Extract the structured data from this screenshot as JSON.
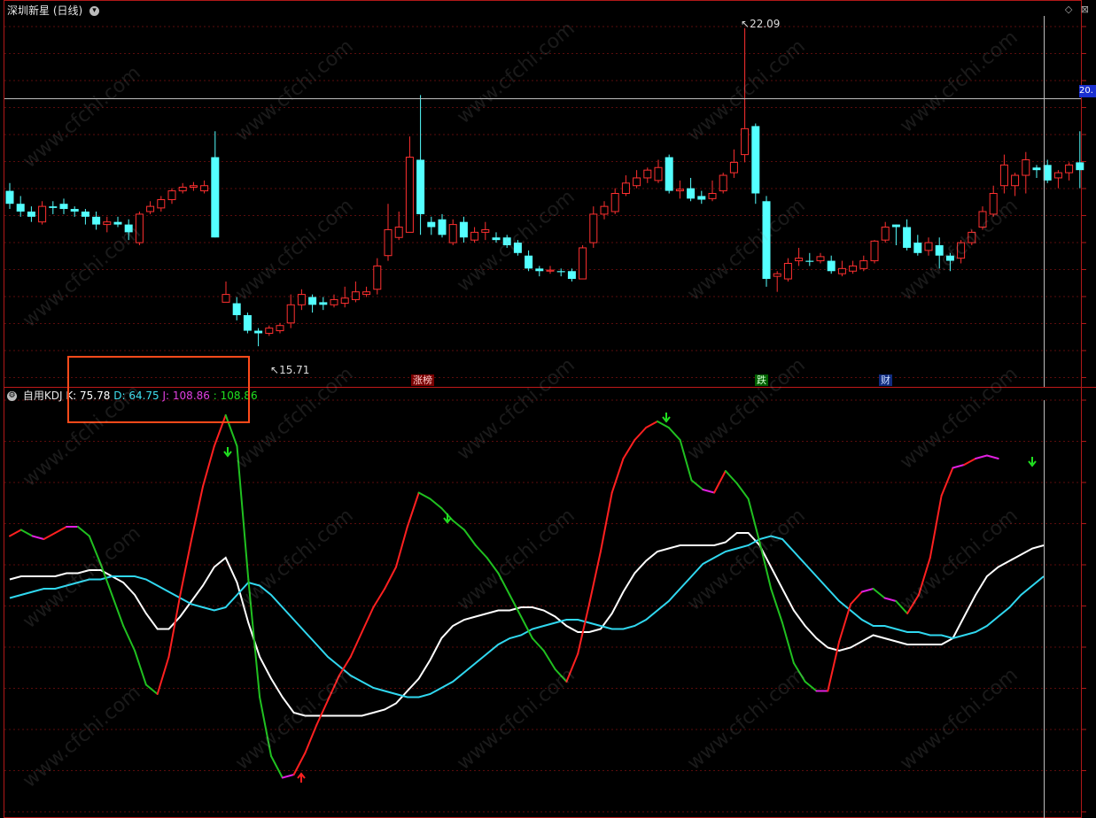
{
  "title": "深圳新星 (日线)",
  "title_icon": "chevron-down-icon",
  "corner_icons": [
    "diamond-icon",
    "close-icon"
  ],
  "price_tag": "20.",
  "kdj": {
    "name": "自用KDJ",
    "k_label": "K: 75.78",
    "d_label": "D: 64.75",
    "j_label": "J: 108.86",
    "j2_label": ": 108.86"
  },
  "markers": {
    "high_label": "22.09",
    "low_label": "15.71",
    "tag1": "涨榜",
    "tag2": "跌",
    "tag3": "财"
  },
  "watermark": "www.cfchi.com",
  "colors": {
    "up": "#ff3030",
    "down": "#54ffff",
    "k": "#ffffff",
    "d": "#30d8f0",
    "j_up": "#ff2020",
    "j_down": "#20c020",
    "j_flat": "#e020e0"
  },
  "chart_data": [
    {
      "type": "candlestick",
      "title": "深圳新星 (日线)",
      "high_mark": 22.09,
      "low_mark": 15.71,
      "ylim": [
        15.2,
        22.6
      ],
      "candles": [
        [
          18.95,
          18.7,
          19.1,
          18.6
        ],
        [
          18.7,
          18.55,
          18.85,
          18.45
        ],
        [
          18.55,
          18.45,
          18.65,
          18.35
        ],
        [
          18.35,
          18.65,
          18.75,
          18.3
        ],
        [
          18.65,
          18.62,
          18.75,
          18.5
        ],
        [
          18.7,
          18.6,
          18.8,
          18.5
        ],
        [
          18.6,
          18.55,
          18.65,
          18.45
        ],
        [
          18.55,
          18.45,
          18.6,
          18.3
        ],
        [
          18.45,
          18.3,
          18.55,
          18.2
        ],
        [
          18.3,
          18.35,
          18.45,
          18.15
        ],
        [
          18.35,
          18.3,
          18.45,
          18.25
        ],
        [
          18.3,
          18.15,
          18.4,
          18.0
        ],
        [
          17.95,
          18.5,
          18.55,
          17.9
        ],
        [
          18.55,
          18.65,
          18.75,
          18.5
        ],
        [
          18.62,
          18.78,
          18.85,
          18.55
        ],
        [
          18.78,
          18.95,
          19.0,
          18.7
        ],
        [
          18.95,
          19.02,
          19.1,
          18.9
        ],
        [
          19.02,
          19.05,
          19.12,
          18.95
        ],
        [
          18.95,
          19.05,
          19.15,
          18.9
        ],
        [
          19.6,
          18.05,
          20.1,
          18.05
        ],
        [
          16.8,
          16.95,
          17.2,
          16.8
        ],
        [
          16.78,
          16.55,
          16.9,
          16.45
        ],
        [
          16.55,
          16.25,
          16.6,
          16.2
        ],
        [
          16.25,
          16.2,
          16.3,
          15.95
        ],
        [
          16.2,
          16.3,
          16.35,
          16.15
        ],
        [
          16.25,
          16.35,
          16.4,
          16.2
        ],
        [
          16.4,
          16.75,
          16.95,
          16.3
        ],
        [
          16.75,
          16.95,
          17.05,
          16.65
        ],
        [
          16.9,
          16.75,
          16.95,
          16.6
        ],
        [
          16.8,
          16.75,
          16.9,
          16.65
        ],
        [
          16.75,
          16.85,
          16.95,
          16.7
        ],
        [
          16.78,
          16.88,
          17.1,
          16.7
        ],
        [
          16.85,
          17.0,
          17.2,
          16.8
        ],
        [
          16.95,
          17.0,
          17.1,
          16.9
        ],
        [
          17.05,
          17.5,
          17.65,
          16.95
        ],
        [
          17.7,
          18.2,
          18.7,
          17.6
        ],
        [
          18.05,
          18.25,
          18.55,
          18.0
        ],
        [
          18.15,
          19.6,
          20.0,
          18.15
        ],
        [
          19.55,
          18.5,
          20.8,
          18.1
        ],
        [
          18.35,
          18.25,
          18.45,
          18.1
        ],
        [
          18.4,
          18.1,
          18.5,
          18.05
        ],
        [
          17.95,
          18.3,
          18.4,
          17.9
        ],
        [
          18.35,
          18.05,
          18.45,
          17.95
        ],
        [
          18.0,
          18.15,
          18.25,
          17.95
        ],
        [
          18.15,
          18.2,
          18.35,
          18.0
        ],
        [
          18.05,
          18.0,
          18.15,
          17.95
        ],
        [
          18.05,
          17.9,
          18.1,
          17.85
        ],
        [
          17.95,
          17.75,
          18.0,
          17.7
        ],
        [
          17.7,
          17.45,
          17.8,
          17.4
        ],
        [
          17.45,
          17.4,
          17.5,
          17.3
        ],
        [
          17.4,
          17.42,
          17.5,
          17.35
        ],
        [
          17.4,
          17.38,
          17.45,
          17.3
        ],
        [
          17.4,
          17.25,
          17.45,
          17.2
        ],
        [
          17.25,
          17.85,
          17.9,
          17.25
        ],
        [
          17.95,
          18.5,
          18.65,
          17.85
        ],
        [
          18.5,
          18.65,
          18.75,
          18.4
        ],
        [
          18.55,
          18.9,
          19.0,
          18.5
        ],
        [
          18.9,
          19.1,
          19.25,
          18.85
        ],
        [
          19.05,
          19.2,
          19.35,
          19.0
        ],
        [
          19.2,
          19.35,
          19.4,
          19.1
        ],
        [
          19.15,
          19.4,
          19.55,
          19.1
        ],
        [
          19.6,
          18.95,
          19.65,
          18.9
        ],
        [
          18.95,
          18.98,
          19.15,
          18.8
        ],
        [
          19.0,
          18.8,
          19.2,
          18.75
        ],
        [
          18.85,
          18.78,
          18.95,
          18.7
        ],
        [
          18.8,
          18.9,
          19.15,
          18.75
        ],
        [
          18.95,
          19.25,
          19.3,
          18.9
        ],
        [
          19.3,
          19.5,
          19.75,
          19.2
        ],
        [
          19.65,
          20.15,
          22.09,
          19.5
        ],
        [
          20.2,
          18.9,
          20.25,
          18.7
        ],
        [
          18.75,
          17.25,
          18.85,
          17.1
        ],
        [
          17.3,
          17.35,
          17.4,
          17.0
        ],
        [
          17.25,
          17.55,
          17.65,
          17.2
        ],
        [
          17.6,
          17.65,
          17.85,
          17.5
        ],
        [
          17.6,
          17.58,
          17.75,
          17.5
        ],
        [
          17.6,
          17.68,
          17.75,
          17.55
        ],
        [
          17.6,
          17.4,
          17.7,
          17.35
        ],
        [
          17.35,
          17.45,
          17.6,
          17.3
        ],
        [
          17.4,
          17.5,
          17.6,
          17.35
        ],
        [
          17.45,
          17.6,
          17.7,
          17.4
        ],
        [
          17.6,
          17.98,
          18.0,
          17.55
        ],
        [
          18.0,
          18.25,
          18.35,
          17.95
        ],
        [
          18.3,
          18.25,
          18.3,
          17.9
        ],
        [
          18.25,
          17.85,
          18.4,
          17.8
        ],
        [
          17.95,
          17.75,
          18.1,
          17.7
        ],
        [
          17.8,
          17.95,
          18.05,
          17.7
        ],
        [
          17.9,
          17.7,
          18.05,
          17.45
        ],
        [
          17.7,
          17.6,
          17.75,
          17.4
        ],
        [
          17.65,
          17.95,
          18.0,
          17.55
        ],
        [
          17.95,
          18.15,
          18.2,
          17.9
        ],
        [
          18.25,
          18.55,
          18.65,
          18.2
        ],
        [
          18.5,
          18.9,
          19.05,
          18.45
        ],
        [
          19.05,
          19.45,
          19.65,
          18.9
        ],
        [
          19.05,
          19.25,
          19.3,
          18.85
        ],
        [
          19.25,
          19.55,
          19.7,
          18.9
        ],
        [
          19.4,
          19.35,
          19.45,
          19.2
        ],
        [
          19.45,
          19.15,
          19.55,
          19.1
        ],
        [
          19.2,
          19.3,
          19.35,
          19.0
        ],
        [
          19.3,
          19.45,
          19.5,
          19.15
        ],
        [
          19.5,
          19.35,
          20.1,
          19.0
        ]
      ]
    },
    {
      "type": "line",
      "title": "自用KDJ",
      "series": [
        {
          "name": "K",
          "values": [
            65,
            66,
            66,
            66,
            66,
            67,
            67,
            68,
            68,
            66,
            64,
            60,
            54,
            49,
            49,
            53,
            58,
            63,
            69,
            72,
            64,
            51,
            40,
            33,
            27,
            22,
            21,
            21,
            21,
            21,
            21,
            21,
            22,
            23,
            25,
            29,
            33,
            39,
            46,
            50,
            52,
            53,
            54,
            55,
            55,
            56,
            56,
            55,
            53,
            50,
            48,
            48,
            49,
            54,
            61,
            67,
            71,
            74,
            75,
            76,
            76,
            76,
            76,
            77,
            80,
            80,
            76,
            69,
            62,
            55,
            50,
            46,
            43,
            42,
            43,
            45,
            47,
            46,
            45,
            44,
            44,
            44,
            44,
            46,
            53,
            60,
            66,
            69,
            71,
            73,
            75,
            76
          ]
        },
        {
          "name": "D",
          "values": [
            59,
            60,
            61,
            62,
            62,
            63,
            64,
            65,
            65,
            66,
            66,
            66,
            65,
            63,
            61,
            59,
            57,
            56,
            55,
            56,
            60,
            64,
            63,
            60,
            56,
            52,
            48,
            44,
            40,
            37,
            34,
            32,
            30,
            29,
            28,
            27,
            27,
            28,
            30,
            32,
            35,
            38,
            41,
            44,
            46,
            47,
            49,
            50,
            51,
            52,
            52,
            51,
            50,
            49,
            49,
            50,
            52,
            55,
            58,
            62,
            66,
            70,
            72,
            74,
            75,
            76,
            78,
            79,
            78,
            74,
            70,
            66,
            62,
            58,
            55,
            52,
            50,
            50,
            49,
            48,
            48,
            47,
            47,
            46,
            47,
            48,
            50,
            53,
            56,
            60,
            63,
            66
          ]
        },
        {
          "name": "J",
          "values": [
            79,
            81,
            79,
            78,
            80,
            82,
            82,
            79,
            70,
            60,
            50,
            42,
            31,
            28,
            40,
            60,
            78,
            95,
            108,
            118,
            108,
            65,
            27,
            8,
            1,
            2,
            9,
            18,
            26,
            34,
            40,
            48,
            56,
            62,
            69,
            82,
            93,
            91,
            88,
            84,
            81,
            76,
            72,
            67,
            60,
            53,
            46,
            42,
            36,
            32,
            41,
            57,
            74,
            93,
            104,
            110,
            114,
            116,
            114,
            110,
            97,
            94,
            93,
            100,
            96,
            91,
            77,
            62,
            51,
            38,
            32,
            29,
            29,
            45,
            57,
            61,
            62,
            59,
            58,
            54,
            60,
            72,
            92,
            101,
            102,
            104,
            105,
            104
          ]
        }
      ]
    }
  ]
}
